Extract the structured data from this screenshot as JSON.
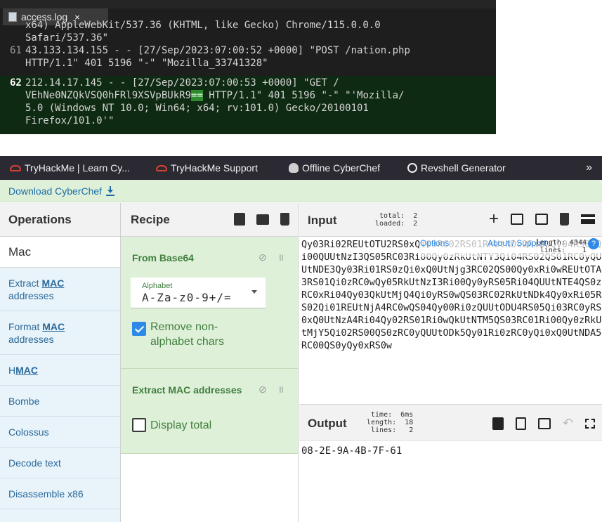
{
  "editor": {
    "tab_label": "access.log",
    "tab_close": "×",
    "lines": [
      {
        "num": "",
        "text": "x64) AppleWebKit/537.36 (KHTML, like Gecko) Chrome/115.0.0.0"
      },
      {
        "num": "",
        "text": "Safari/537.36\""
      },
      {
        "num": "61",
        "text": "43.133.134.155 - - [27/Sep/2023:07:00:52 +0000] \"POST /nation.php"
      },
      {
        "num": "",
        "text": "HTTP/1.1\" 401 5196 \"-\" \"Mozilla_33741328\""
      },
      {
        "num": "62",
        "text": "212.14.17.145 - - [27/Sep/2023:07:00:53 +0000] \"GET /"
      },
      {
        "num": "",
        "text_pre": "VEhNe0NZQkVSQ0hFRl9XSVpBUkR9",
        "text_mark": "==",
        "text_post": " HTTP/1.1\" 401 5196 \"-\" \"'Mozilla/"
      },
      {
        "num": "",
        "text": "5.0 (Windows NT 10.0; Win64; x64; rv:101.0) Gecko/20100101"
      },
      {
        "num": "",
        "text": "Firefox/101.0'\""
      }
    ]
  },
  "bookmarks": [
    {
      "label": "TryHackMe | Learn Cy...",
      "icon": "tryhackme-icon"
    },
    {
      "label": "TryHackMe Support",
      "icon": "tryhackme-icon"
    },
    {
      "label": "Offline CyberChef",
      "icon": "cyberchef-icon"
    },
    {
      "label": "Revshell Generator",
      "icon": "globe-icon"
    }
  ],
  "bookmarks_more": "»",
  "banner": {
    "label": "Download CyberChef"
  },
  "operations": {
    "title": "Operations",
    "search_value": "Mac",
    "items": [
      {
        "pre": "Extract ",
        "match": "MAC",
        "post": "addresses"
      },
      {
        "pre": "Format ",
        "match": "MAC",
        "post": "addresses"
      },
      {
        "pre": "H",
        "match": "MAC",
        "post": ""
      },
      {
        "pre": "Bombe",
        "match": "",
        "post": ""
      },
      {
        "pre": "Colossus",
        "match": "",
        "post": ""
      },
      {
        "pre": "Decode text",
        "match": "",
        "post": ""
      },
      {
        "pre": "Disassemble x86",
        "match": "",
        "post": ""
      }
    ]
  },
  "recipe": {
    "title": "Recipe",
    "op1": {
      "name": "From Base64",
      "alphabet_label": "Alphabet",
      "alphabet_value": "A-Za-z0-9+/=",
      "checkbox_label": "Remove non-alphabet chars",
      "checked": true
    },
    "op2": {
      "name": "Extract MAC addresses",
      "checkbox_label": "Display total",
      "checked": false
    }
  },
  "input": {
    "title": "Input",
    "stats": "total:  2\nloaded:  2",
    "options_label": "Options",
    "about_label": "About / Support",
    "length_stats": "length: 4344\nlines:    1",
    "text": "Qy03Ri02REUtOTU2RS0xQi03RC02RS01RkUtNDc2Ri0wQy04RS01Qi00QUUtNzI3QS05RC03Ri00Qy0zRkUtNTY3Qi04RS02QS01RC0yQUUtNDE3Qy03Ri01RS0zQi0xQ0UtNjg3RC02QS00Qy0xRi0wREUtOTA3RS01Qi0zRC0wQy05RkUtNzI3Ri00Qy0yRS05Ri04QUUtNTE4QS0zRC0xRi04Qy03QkUtMjQ4Qi0yRS0wQS03RC02RkUtNDk4Qy0xRi05RS02Qi01REUtNjA4RC0wQS04Qy00Ri0zQUUtODU4RS05Qi03RC0yRS0xQ0UtNzA4Ri04Qy02RS01Ri0wQkUtNTM5QS03RC01Ri00Qy0zRkUtMjY5Qi02RS00QS0zRC0yQUUtODk5Qy01Ri0zRC0yQi0xQ0UtNDA5RC00QS0yQy0xRS0w"
  },
  "output": {
    "title": "Output",
    "stats": "time:  6ms\nlength:  18\nlines:   2",
    "text": "08-2E-9A-4B-7F-61"
  }
}
